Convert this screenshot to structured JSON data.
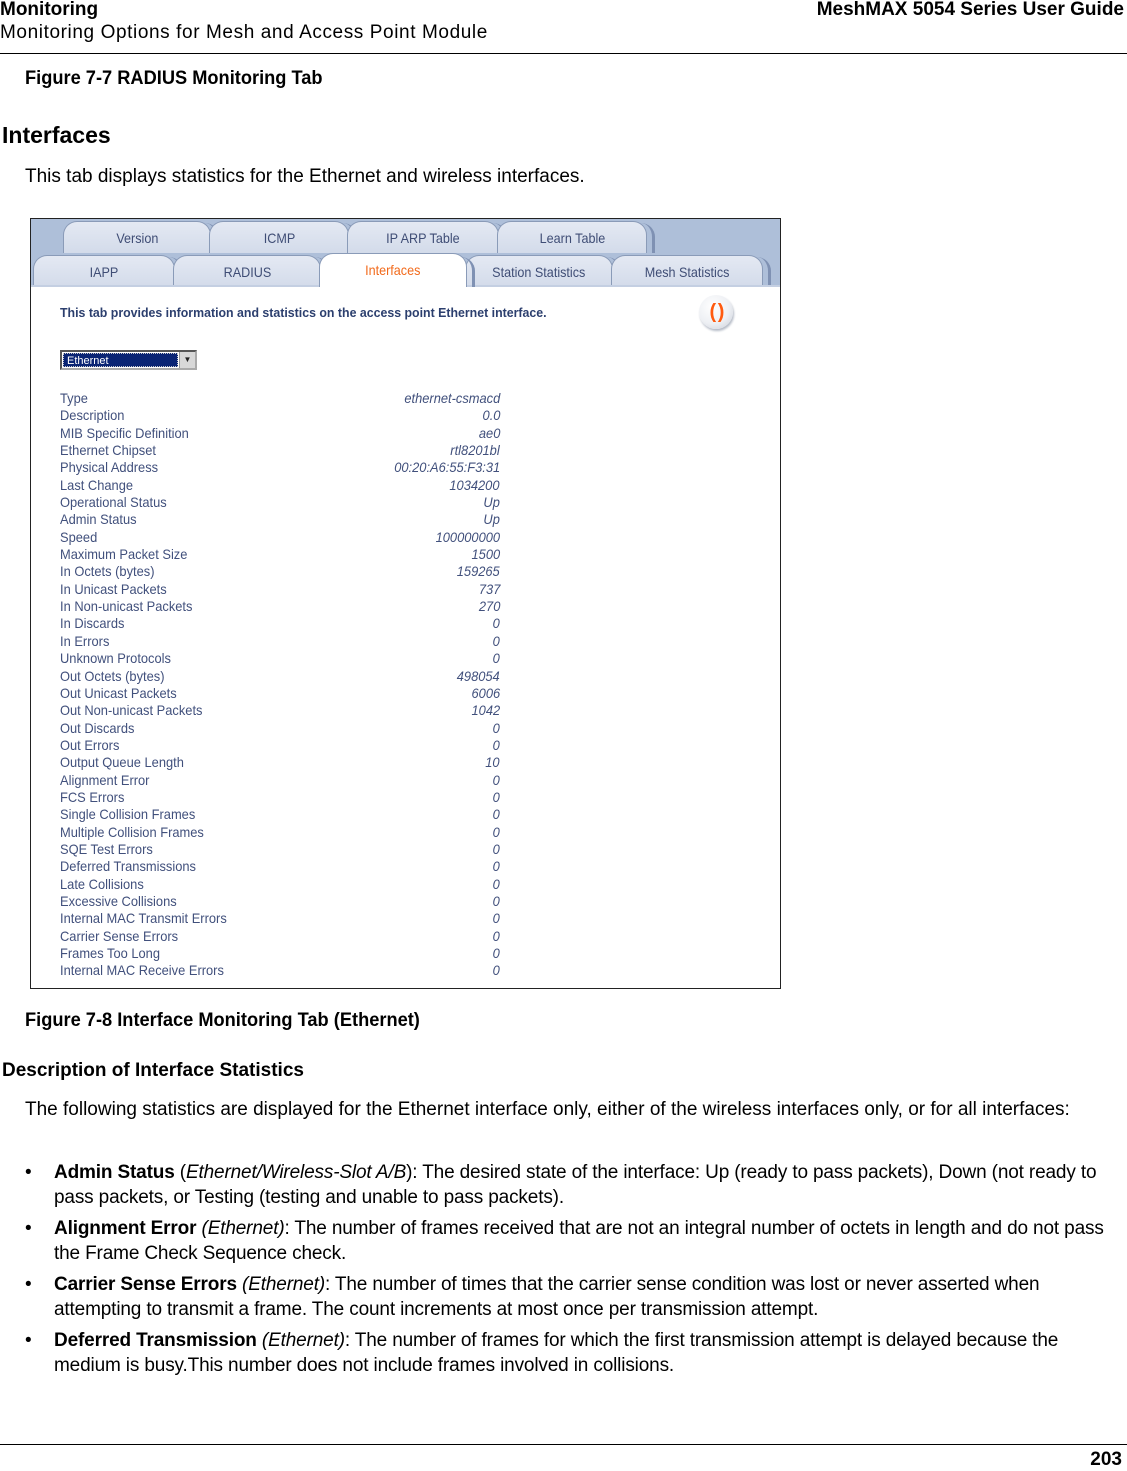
{
  "header": {
    "section": "Monitoring",
    "subsection": "Monitoring Options for Mesh and Access Point Module",
    "guide_title": "MeshMAX 5054 Series User Guide"
  },
  "figure_7_7_caption": "Figure 7-7 RADIUS Monitoring Tab",
  "interfaces_heading": "Interfaces",
  "interfaces_intro": "This tab displays statistics for the Ethernet and wireless interfaces.",
  "screenshot": {
    "tabs_row1": [
      {
        "label": "Version"
      },
      {
        "label": "ICMP"
      },
      {
        "label": "IP ARP Table"
      },
      {
        "label": "Learn Table"
      }
    ],
    "tabs_row2": [
      {
        "label": "IAPP"
      },
      {
        "label": "RADIUS"
      },
      {
        "label": "Interfaces",
        "active": true
      },
      {
        "label": "Station Statistics"
      },
      {
        "label": "Mesh Statistics"
      }
    ],
    "description": "This tab provides information and statistics on the access point Ethernet interface.",
    "refresh_icon": "refresh-icon",
    "interface_select": {
      "value": "Ethernet"
    },
    "colors": {
      "active_tab_text": "#f26a1b",
      "tab_text": "#3f4d75",
      "tab_bar_bg": "#aebfd9",
      "stat_text": "#41507c",
      "select_bg": "#0a2474"
    },
    "stats": [
      {
        "label": "Type",
        "value": "ethernet-csmacd"
      },
      {
        "label": "Description",
        "value": "0.0"
      },
      {
        "label": "MIB Specific Definition",
        "value": "ae0"
      },
      {
        "label": "Ethernet Chipset",
        "value": "rtl8201bl"
      },
      {
        "label": "Physical Address",
        "value": "00:20:A6:55:F3:31"
      },
      {
        "label": "Last Change",
        "value": "1034200"
      },
      {
        "label": "Operational Status",
        "value": "Up"
      },
      {
        "label": "Admin Status",
        "value": "Up"
      },
      {
        "label": "Speed",
        "value": "100000000"
      },
      {
        "label": "Maximum Packet Size",
        "value": "1500"
      },
      {
        "label": "In Octets (bytes)",
        "value": "159265"
      },
      {
        "label": "In Unicast Packets",
        "value": "737"
      },
      {
        "label": "In Non-unicast Packets",
        "value": "270"
      },
      {
        "label": "In Discards",
        "value": "0"
      },
      {
        "label": "In Errors",
        "value": "0"
      },
      {
        "label": "Unknown Protocols",
        "value": "0"
      },
      {
        "label": "Out Octets (bytes)",
        "value": "498054"
      },
      {
        "label": "Out Unicast Packets",
        "value": "6006"
      },
      {
        "label": "Out Non-unicast Packets",
        "value": "1042"
      },
      {
        "label": "Out Discards",
        "value": "0"
      },
      {
        "label": "Out Errors",
        "value": "0"
      },
      {
        "label": "Output Queue Length",
        "value": "10"
      },
      {
        "label": "Alignment Error",
        "value": "0"
      },
      {
        "label": "FCS Errors",
        "value": "0"
      },
      {
        "label": "Single Collision Frames",
        "value": "0"
      },
      {
        "label": "Multiple Collision Frames",
        "value": "0"
      },
      {
        "label": "SQE Test Errors",
        "value": "0"
      },
      {
        "label": "Deferred Transmissions",
        "value": "0"
      },
      {
        "label": "Late Collisions",
        "value": "0"
      },
      {
        "label": "Excessive Collisions",
        "value": "0"
      },
      {
        "label": "Internal MAC Transmit Errors",
        "value": "0"
      },
      {
        "label": "Carrier Sense Errors",
        "value": "0"
      },
      {
        "label": "Frames Too Long",
        "value": "0"
      },
      {
        "label": "Internal MAC Receive Errors",
        "value": "0"
      }
    ]
  },
  "figure_7_8_caption": "Figure 7-8 Interface Monitoring Tab (Ethernet)",
  "description_heading": "Description of Interface Statistics",
  "description_intro": "The following statistics are displayed for the Ethernet interface only, either of the wireless interfaces only, or for all interfaces:",
  "bullets": [
    {
      "term": "Admin Status",
      "pre": " (",
      "scope": "Ethernet/Wireless-Slot A/B",
      "post": "): The desired state of the interface: Up (ready to pass packets), Down (not ready to pass packets, or Testing (testing and unable to pass packets)."
    },
    {
      "term": "Alignment Error",
      "pre": " ",
      "scope": "(Ethernet)",
      "post": ": The number of frames received that are not an integral number of octets in length and do not pass the Frame Check Sequence check."
    },
    {
      "term": "Carrier Sense Errors",
      "pre": " ",
      "scope": "(Ethernet)",
      "post": ": The number of times that the carrier sense condition was lost or never asserted when attempting to transmit a frame. The count increments at most once per transmission attempt."
    },
    {
      "term": "Deferred Transmission",
      "pre": " ",
      "scope": "(Ethernet)",
      "post": ": The number of frames for which the first transmission attempt is delayed because the medium is busy.This number does not include frames involved in collisions."
    }
  ],
  "bullet_char": "•",
  "page_number": "203"
}
